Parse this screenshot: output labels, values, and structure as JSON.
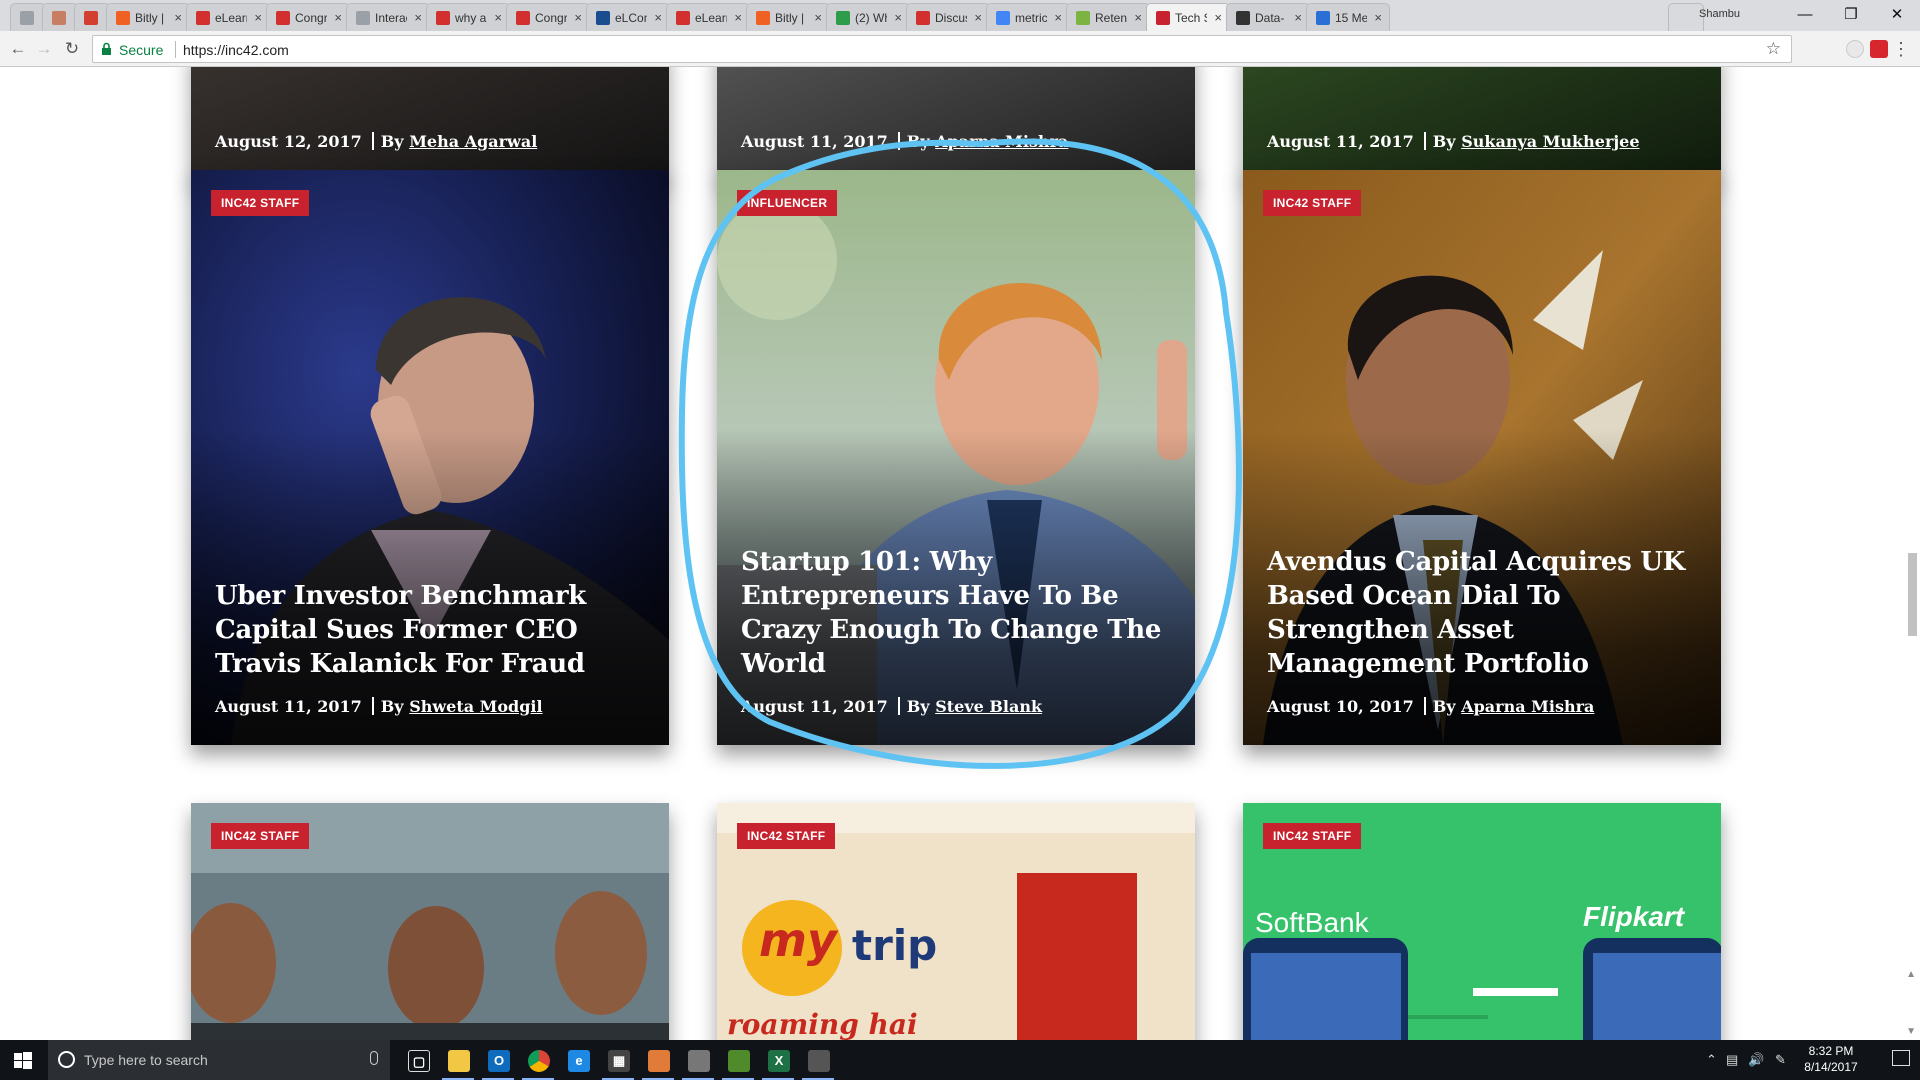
{
  "browser": {
    "tabs": [
      {
        "label": "",
        "color": "#9aa0a6",
        "icon": "page-icon"
      },
      {
        "label": "",
        "color": "#c77e62",
        "icon": "extension-icon"
      },
      {
        "label": "",
        "color": "#d23f31",
        "icon": "grid-icon"
      },
      {
        "label": "Bitly |",
        "color": "#ee6123",
        "icon": "bitly-icon"
      },
      {
        "label": "eLearn",
        "color": "#d32f2f",
        "icon": "acrobat-icon"
      },
      {
        "label": "Congr",
        "color": "#d32f2f",
        "icon": "acrobat-icon"
      },
      {
        "label": "Interac",
        "color": "#9aa0a6",
        "icon": "page-icon"
      },
      {
        "label": "why a",
        "color": "#d32f2f",
        "icon": "acrobat-icon"
      },
      {
        "label": "Congr",
        "color": "#d32f2f",
        "icon": "acrobat-icon"
      },
      {
        "label": "eLCon",
        "color": "#1a4d8f",
        "icon": "elcon-icon"
      },
      {
        "label": "eLearn",
        "color": "#d32f2f",
        "icon": "acrobat-icon"
      },
      {
        "label": "Bitly |",
        "color": "#ee6123",
        "icon": "bitly-icon"
      },
      {
        "label": "(2) Wh",
        "color": "#2e9d4b",
        "icon": "whatsapp-icon"
      },
      {
        "label": "Discus",
        "color": "#d32f2f",
        "icon": "acrobat-icon"
      },
      {
        "label": "metric",
        "color": "#4285f4",
        "icon": "google-icon"
      },
      {
        "label": "Retent",
        "color": "#7cb342",
        "icon": "shopify-icon"
      },
      {
        "label": "Tech S",
        "color": "#c8222f",
        "icon": "inc42-icon",
        "active": true
      },
      {
        "label": "Data-",
        "color": "#333333",
        "icon": "github-icon"
      },
      {
        "label": "15 Me",
        "color": "#2a6fd6",
        "icon": "info-icon"
      }
    ],
    "profile_name": "Shambu",
    "secure_label": "Secure",
    "url": "https://inc42.com"
  },
  "articles": [
    {
      "badge": "",
      "title": "",
      "date": "August 12, 2017",
      "by": "By",
      "author": "Meha Agarwal",
      "image": "dark"
    },
    {
      "badge": "",
      "title": "",
      "date": "August 11, 2017",
      "by": "By",
      "author": "Aparna Mishra",
      "image": "dark-grey"
    },
    {
      "badge": "",
      "title": "",
      "date": "August 11, 2017",
      "by": "By",
      "author": "Sukanya Mukherjee",
      "image": "dark-green"
    },
    {
      "badge": "INC42 STAFF",
      "title": "Uber Investor Benchmark Capital Sues Former CEO Travis Kalanick For Fraud",
      "date": "August 11, 2017",
      "by": "By",
      "author": "Shweta Modgil",
      "image": "portrait-dark-blue"
    },
    {
      "badge": "INFLUENCER",
      "title": "Startup 101: Why Entrepreneurs Have To Be Crazy Enough To Change The World",
      "date": "August 11, 2017",
      "by": "By",
      "author": "Steve Blank",
      "image": "laughing-man-laptop"
    },
    {
      "badge": "INC42 STAFF",
      "title": "Avendus Capital Acquires UK Based Ocean Dial To Strengthen Asset Management Portfolio",
      "date": "August 10, 2017",
      "by": "By",
      "author": "Aparna Mishra",
      "image": "portrait-amber-office"
    },
    {
      "badge": "INC42 STAFF",
      "title": "",
      "date": "",
      "by": "",
      "author": "",
      "image": "three-founders"
    },
    {
      "badge": "INC42 STAFF",
      "title": "",
      "date": "",
      "by": "",
      "author": "",
      "image": "makemytrip-office",
      "brand_text_1": "my",
      "brand_text_2": "trip",
      "tagline": "roaming hai"
    },
    {
      "badge": "INC42 STAFF",
      "title": "",
      "date": "",
      "by": "",
      "author": "",
      "image": "softbank-flipkart",
      "brand_text_1": "SoftBank",
      "brand_text_2": "Flipkart"
    }
  ],
  "taskbar": {
    "search_placeholder": "Type here to search",
    "apps": [
      "task-view-icon",
      "file-explorer-icon",
      "outlook-icon",
      "chrome-icon",
      "edge-icon",
      "calculator-icon",
      "java-icon",
      "snipping-icon",
      "notepad-icon",
      "excel-icon",
      "settings-app-icon"
    ],
    "time": "8:32 PM",
    "date": "8/14/2017"
  },
  "colors": {
    "badge": "#c8222f",
    "annotation": "#5ec3f2",
    "secure": "#0b8043"
  }
}
